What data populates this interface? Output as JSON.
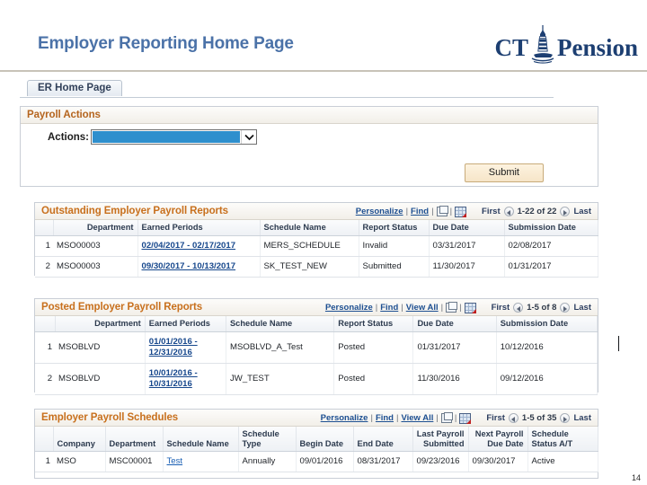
{
  "slide": {
    "title": "Employer Reporting Home Page",
    "page_number": "14",
    "brand": {
      "ct": "CT",
      "pension": "Pension",
      "icon": "lighthouse-icon",
      "color": "#1d3f72"
    },
    "title_color": "#4b72a8"
  },
  "tabs": [
    {
      "label": "ER Home Page",
      "active": true
    }
  ],
  "payroll_actions": {
    "title": "Payroll Actions",
    "actions_label": "Actions:",
    "actions_value": "",
    "actions_placeholder": "",
    "submit_label": "Submit"
  },
  "outstanding_reports": {
    "title": "Outstanding Employer Payroll Reports",
    "toolbar": {
      "personalize": "Personalize",
      "find": "Find",
      "view_all": null,
      "expand_icon": "expand-icon",
      "grid_icon": "download-to-excel-icon"
    },
    "pager": {
      "first": "First",
      "prev_icon": "prev-arrow-icon",
      "range": "1-22 of 22",
      "next_icon": "next-arrow-icon",
      "last": "Last"
    },
    "columns": [
      "",
      "Department",
      "Earned Periods",
      "Schedule Name",
      "Report Status",
      "Due Date",
      "Submission Date"
    ],
    "rows": [
      {
        "num": "1",
        "department": "MSO00003",
        "earned_periods": "02/04/2017 - 02/17/2017",
        "schedule_name": "MERS_SCHEDULE",
        "report_status": "Invalid",
        "due_date": "03/31/2017",
        "submission_date": "02/08/2017"
      },
      {
        "num": "2",
        "department": "MSO00003",
        "earned_periods": "09/30/2017 - 10/13/2017",
        "schedule_name": "SK_TEST_NEW",
        "report_status": "Submitted",
        "due_date": "11/30/2017",
        "submission_date": "01/31/2017"
      }
    ]
  },
  "posted_reports": {
    "title": "Posted Employer Payroll Reports",
    "toolbar": {
      "personalize": "Personalize",
      "find": "Find",
      "view_all": "View All",
      "expand_icon": "expand-icon",
      "grid_icon": "download-to-excel-icon"
    },
    "pager": {
      "first": "First",
      "prev_icon": "prev-arrow-icon",
      "range": "1-5 of 8",
      "next_icon": "next-arrow-icon",
      "last": "Last"
    },
    "columns": [
      "",
      "Department",
      "Earned Periods",
      "Schedule Name",
      "Report Status",
      "Due Date",
      "Submission Date"
    ],
    "rows": [
      {
        "num": "1",
        "department": "MSOBLVD",
        "earned_periods": "01/01/2016 - 12/31/2016",
        "schedule_name": "MSOBLVD_A_Test",
        "report_status": "Posted",
        "due_date": "01/31/2017",
        "submission_date": "10/12/2016"
      },
      {
        "num": "2",
        "department": "MSOBLVD",
        "earned_periods": "10/01/2016 - 10/31/2016",
        "schedule_name": "JW_TEST",
        "report_status": "Posted",
        "due_date": "11/30/2016",
        "submission_date": "09/12/2016"
      }
    ]
  },
  "payroll_schedules": {
    "title": "Employer Payroll Schedules",
    "toolbar": {
      "personalize": "Personalize",
      "find": "Find",
      "view_all": "View All",
      "expand_icon": "expand-icon",
      "grid_icon": "download-to-excel-icon"
    },
    "pager": {
      "first": "First",
      "prev_icon": "prev-arrow-icon",
      "range": "1-5 of 35",
      "next_icon": "next-arrow-icon",
      "last": "Last"
    },
    "columns": [
      "",
      "Company",
      "Department",
      "Schedule Name",
      "Schedule Type",
      "Begin Date",
      "End Date",
      "Last Payroll Submitted",
      "Next Payroll Due Date",
      "Schedule Status A/T"
    ],
    "rows": [
      {
        "num": "1",
        "company": "MSO",
        "department": "MSC00001",
        "schedule_name": "Test",
        "schedule_type": "Annually",
        "begin_date": "09/01/2016",
        "end_date": "08/31/2017",
        "last_payroll_submitted": "09/23/2016",
        "next_payroll_due_date": "09/30/2017",
        "schedule_status": "Active"
      }
    ]
  }
}
